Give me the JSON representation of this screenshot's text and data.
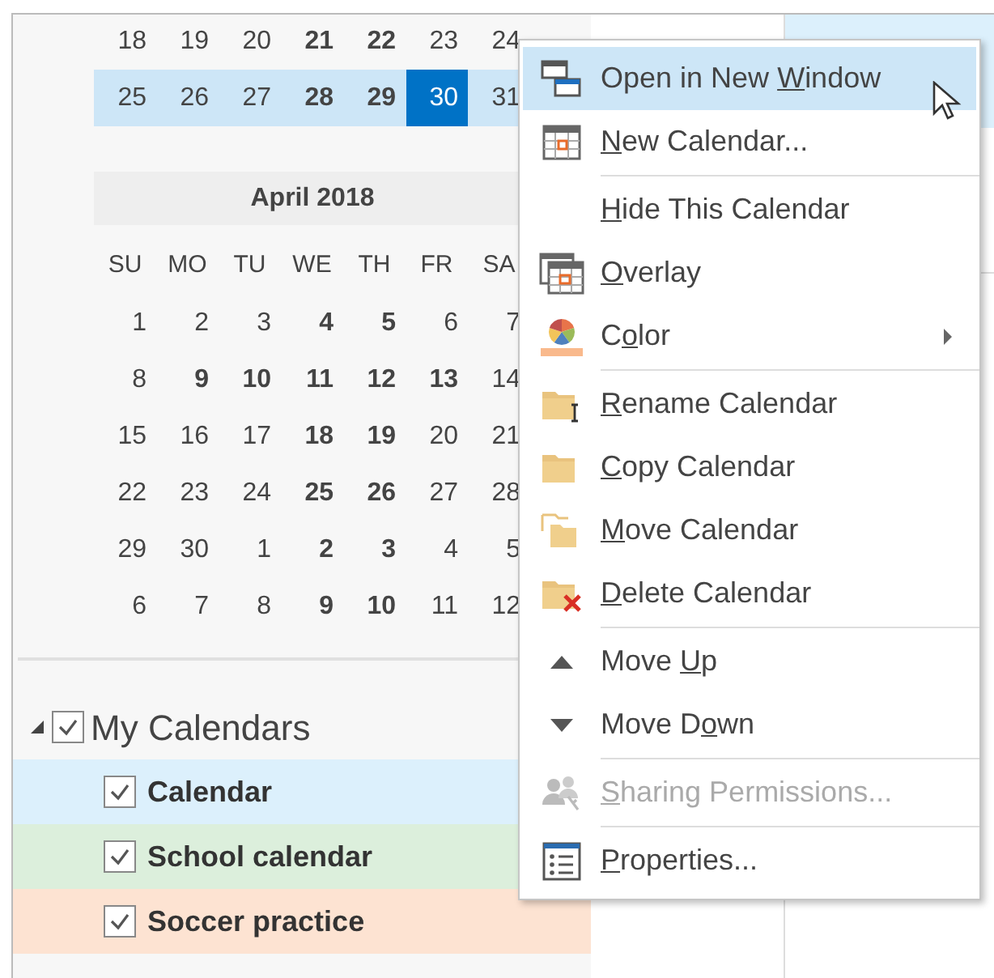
{
  "march_weeks": [
    {
      "highlighted": false,
      "days": [
        {
          "d": "18",
          "bold": false,
          "selected": false
        },
        {
          "d": "19",
          "bold": false,
          "selected": false
        },
        {
          "d": "20",
          "bold": false,
          "selected": false
        },
        {
          "d": "21",
          "bold": true,
          "selected": false
        },
        {
          "d": "22",
          "bold": true,
          "selected": false
        },
        {
          "d": "23",
          "bold": false,
          "selected": false
        },
        {
          "d": "24",
          "bold": false,
          "selected": false
        }
      ]
    },
    {
      "highlighted": true,
      "days": [
        {
          "d": "25",
          "bold": false,
          "selected": false
        },
        {
          "d": "26",
          "bold": false,
          "selected": false
        },
        {
          "d": "27",
          "bold": false,
          "selected": false
        },
        {
          "d": "28",
          "bold": true,
          "selected": false
        },
        {
          "d": "29",
          "bold": true,
          "selected": false
        },
        {
          "d": "30",
          "bold": false,
          "selected": true
        },
        {
          "d": "31",
          "bold": false,
          "selected": false
        }
      ]
    }
  ],
  "april": {
    "title": "April 2018",
    "weekdays": [
      "SU",
      "MO",
      "TU",
      "WE",
      "TH",
      "FR",
      "SA"
    ],
    "weeks": [
      {
        "days": [
          {
            "d": "1",
            "bold": false
          },
          {
            "d": "2",
            "bold": false
          },
          {
            "d": "3",
            "bold": false
          },
          {
            "d": "4",
            "bold": true
          },
          {
            "d": "5",
            "bold": true
          },
          {
            "d": "6",
            "bold": false
          },
          {
            "d": "7",
            "bold": false
          }
        ]
      },
      {
        "days": [
          {
            "d": "8",
            "bold": false
          },
          {
            "d": "9",
            "bold": true
          },
          {
            "d": "10",
            "bold": true
          },
          {
            "d": "11",
            "bold": true
          },
          {
            "d": "12",
            "bold": true
          },
          {
            "d": "13",
            "bold": true
          },
          {
            "d": "14",
            "bold": false
          }
        ]
      },
      {
        "days": [
          {
            "d": "15",
            "bold": false
          },
          {
            "d": "16",
            "bold": false
          },
          {
            "d": "17",
            "bold": false
          },
          {
            "d": "18",
            "bold": true
          },
          {
            "d": "19",
            "bold": true
          },
          {
            "d": "20",
            "bold": false
          },
          {
            "d": "21",
            "bold": false
          }
        ]
      },
      {
        "days": [
          {
            "d": "22",
            "bold": false
          },
          {
            "d": "23",
            "bold": false
          },
          {
            "d": "24",
            "bold": false
          },
          {
            "d": "25",
            "bold": true
          },
          {
            "d": "26",
            "bold": true
          },
          {
            "d": "27",
            "bold": false
          },
          {
            "d": "28",
            "bold": false
          }
        ]
      },
      {
        "days": [
          {
            "d": "29",
            "bold": false
          },
          {
            "d": "30",
            "bold": false
          },
          {
            "d": "1",
            "bold": false
          },
          {
            "d": "2",
            "bold": true
          },
          {
            "d": "3",
            "bold": true
          },
          {
            "d": "4",
            "bold": false
          },
          {
            "d": "5",
            "bold": false
          }
        ]
      },
      {
        "days": [
          {
            "d": "6",
            "bold": false
          },
          {
            "d": "7",
            "bold": false
          },
          {
            "d": "8",
            "bold": false
          },
          {
            "d": "9",
            "bold": true
          },
          {
            "d": "10",
            "bold": true
          },
          {
            "d": "11",
            "bold": false
          },
          {
            "d": "12",
            "bold": false
          }
        ]
      }
    ]
  },
  "calendar_group": {
    "label": "My Calendars",
    "expanded": true,
    "checked": true,
    "children": [
      {
        "label": "Calendar",
        "checked": true,
        "color": "#dcf0fc"
      },
      {
        "label": "School calendar",
        "checked": true,
        "color": "#dcefdc"
      },
      {
        "label": "Soccer practice",
        "checked": true,
        "color": "#fde3d2"
      }
    ]
  },
  "context_menu": [
    {
      "kind": "item",
      "label": {
        "pre": "Open in New ",
        "key": "W",
        "post": "indow"
      },
      "selected": true,
      "disabled": false,
      "submenu": false
    },
    {
      "kind": "item",
      "label": {
        "key": "N",
        "post": "ew Calendar..."
      },
      "selected": false,
      "disabled": false,
      "submenu": false
    },
    {
      "kind": "separator"
    },
    {
      "kind": "item",
      "label": {
        "key": "H",
        "post": "ide This Calendar"
      },
      "selected": false,
      "disabled": false,
      "submenu": false
    },
    {
      "kind": "item",
      "label": {
        "key": "O",
        "post": "verlay"
      },
      "selected": false,
      "disabled": false,
      "submenu": false
    },
    {
      "kind": "item",
      "label": {
        "pre": "C",
        "key": "o",
        "post": "lor"
      },
      "selected": false,
      "disabled": false,
      "submenu": true
    },
    {
      "kind": "separator"
    },
    {
      "kind": "item",
      "label": {
        "key": "R",
        "post": "ename Calendar"
      },
      "selected": false,
      "disabled": false,
      "submenu": false
    },
    {
      "kind": "item",
      "label": {
        "key": "C",
        "post": "opy Calendar"
      },
      "selected": false,
      "disabled": false,
      "submenu": false
    },
    {
      "kind": "item",
      "label": {
        "key": "M",
        "post": "ove Calendar"
      },
      "selected": false,
      "disabled": false,
      "submenu": false
    },
    {
      "kind": "item",
      "label": {
        "key": "D",
        "post": "elete Calendar"
      },
      "selected": false,
      "disabled": false,
      "submenu": false
    },
    {
      "kind": "separator"
    },
    {
      "kind": "item",
      "label": {
        "pre": "Move ",
        "key": "U",
        "post": "p"
      },
      "selected": false,
      "disabled": false,
      "submenu": false
    },
    {
      "kind": "item",
      "label": {
        "pre": "Move D",
        "key": "o",
        "post": "wn"
      },
      "selected": false,
      "disabled": false,
      "submenu": false
    },
    {
      "kind": "separator"
    },
    {
      "kind": "item",
      "label": {
        "key": "S",
        "post": "haring Permissions..."
      },
      "selected": false,
      "disabled": true,
      "submenu": false
    },
    {
      "kind": "separator"
    },
    {
      "kind": "item",
      "label": {
        "key": "P",
        "post": "roperties..."
      },
      "selected": false,
      "disabled": false,
      "submenu": false
    }
  ]
}
